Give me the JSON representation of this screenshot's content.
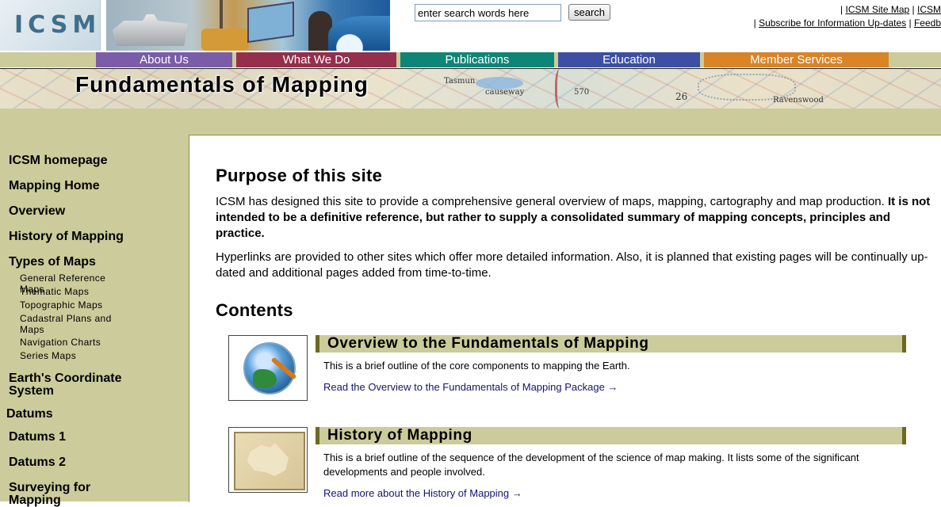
{
  "header": {
    "logo_text": "ICSM",
    "search": {
      "placeholder": "enter search words here",
      "value": "enter search words here",
      "button_label": "search"
    },
    "util_links": {
      "line1_prefix": "| ",
      "site_map": "ICSM Site Map",
      "sep": " | ",
      "icsm_cut": "ICSM",
      "line2_prefix": "| ",
      "subscribe": "Subscribe for Information Up-dates",
      "feedback_cut": "Feedb"
    }
  },
  "nav": {
    "tabs": [
      {
        "label": "About Us",
        "color": "#7b5ca8"
      },
      {
        "label": "What We Do",
        "color": "#952f4c"
      },
      {
        "label": "Publications",
        "color": "#0f8577"
      },
      {
        "label": "Education",
        "color": "#3d4fa3"
      },
      {
        "label": "Member Services",
        "color": "#d88427"
      }
    ]
  },
  "title_band": {
    "title": "Fundamentals of Mapping",
    "map_labels": [
      "Tasmun",
      "causeway",
      "570",
      "26",
      "Ravenswood"
    ]
  },
  "sidebar": {
    "items": [
      {
        "label": "ICSM homepage"
      },
      {
        "label": "Mapping Home"
      },
      {
        "label": "Overview"
      },
      {
        "label": "History of Mapping"
      },
      {
        "label": "Types of Maps"
      }
    ],
    "sub_items": [
      {
        "label": "General Reference Maps"
      },
      {
        "label": "Thematic Maps"
      },
      {
        "label": "Topographic Maps"
      },
      {
        "label": "Cadastral Plans and Maps"
      },
      {
        "label": "Navigation Charts"
      },
      {
        "label": "Series Maps"
      }
    ],
    "items2": [
      {
        "label": "Earth's Coordinate System"
      },
      {
        "label": "Datums"
      },
      {
        "label": "Datums 1"
      },
      {
        "label": "Datums 2"
      },
      {
        "label": "Surveying for Mapping"
      }
    ]
  },
  "content": {
    "purpose_heading": "Purpose of this site",
    "purpose_p1_normal": "ICSM has designed this site to provide a comprehensive general overview of maps, mapping, cartography and map production.  ",
    "purpose_p1_bold": "It is not intended to be a definitive reference, but rather to supply a consolidated summary of mapping concepts, principles and practice.",
    "purpose_p2": "Hyperlinks are provided to other sites which offer more detailed information.  Also, it is planned that existing pages will be continually up-dated and additional pages added from time-to-time.",
    "contents_heading": "Contents",
    "sections": [
      {
        "title": "Overview to the Fundamentals of Mapping",
        "description": "This is a brief outline of the core components to mapping the Earth.",
        "link": "Read the Overview to the Fundamentals of Mapping Package →"
      },
      {
        "title": "History of Mapping",
        "description": "This is a brief outline of the sequence of the development of the science of map making.  It lists some of the significant developments and people involved.",
        "link": "Read more about the History of Mapping →"
      }
    ]
  }
}
